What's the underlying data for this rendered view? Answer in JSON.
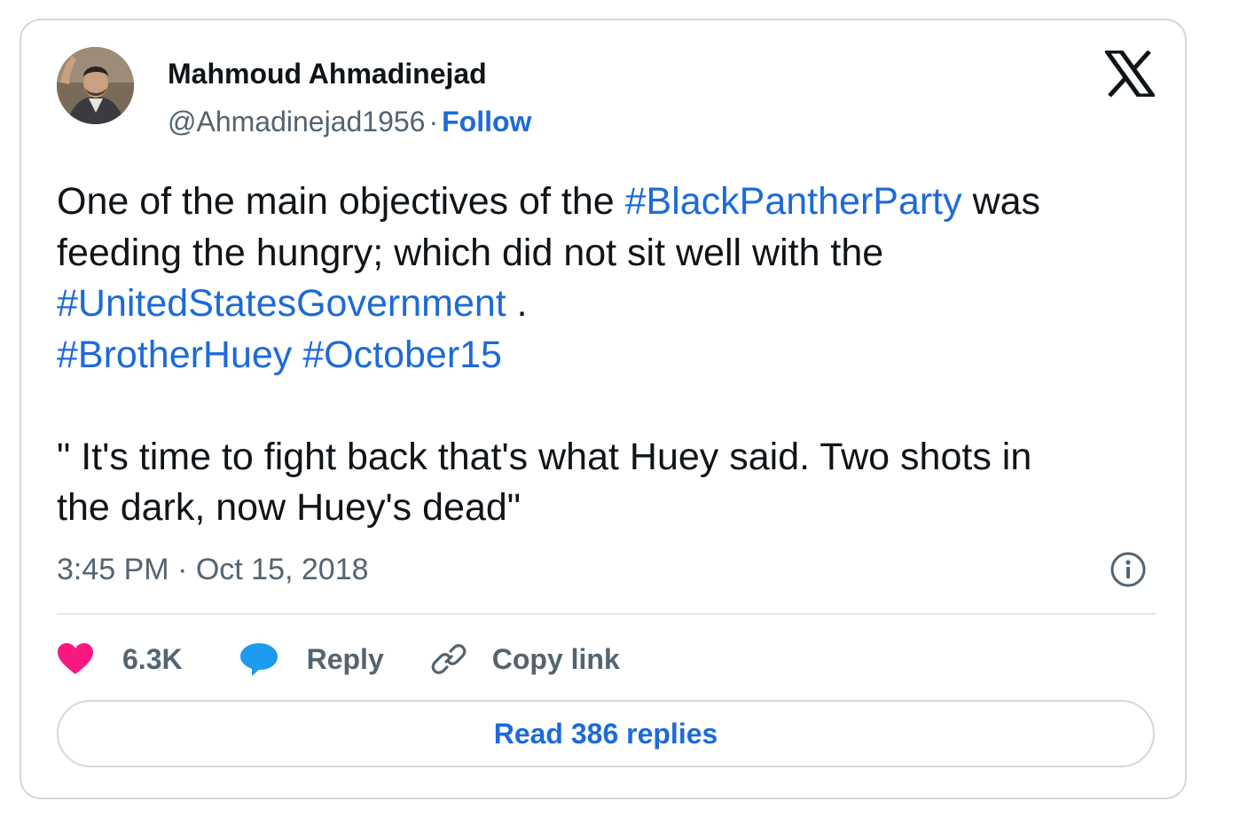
{
  "author": {
    "name": "Mahmoud Ahmadinejad",
    "handle": "@Ahmadinejad1956",
    "separator": "·",
    "follow_label": "Follow"
  },
  "tweet": {
    "line1_pre": "One of the main objectives of the ",
    "tag1": "#BlackPantherParty",
    "line1_post": " was",
    "line2": "feeding the hungry; which did not sit well with the",
    "tag2": "#UnitedStatesGovernment",
    "line3_post": " .",
    "tag3": "#BrotherHuey",
    "tag4": "#October15",
    "quote_line1": "\" It's time to fight back that's what Huey said. Two shots in",
    "quote_line2": "the dark, now Huey's dead\"",
    "timestamp": "3:45 PM · Oct 15, 2018"
  },
  "actions": {
    "like_count": "6.3K",
    "reply_label": "Reply",
    "copy_link_label": "Copy link"
  },
  "read_replies_label": "Read 386 replies",
  "colors": {
    "link": "#1d6ad8",
    "like": "#f91880",
    "reply": "#1d9bf0",
    "secondary_text": "#536471",
    "border": "#cfd9de"
  },
  "icons": {
    "brand": "x-logo-icon",
    "info": "info-icon",
    "like": "heart-icon",
    "reply": "speech-bubble-icon",
    "copy": "link-icon"
  }
}
